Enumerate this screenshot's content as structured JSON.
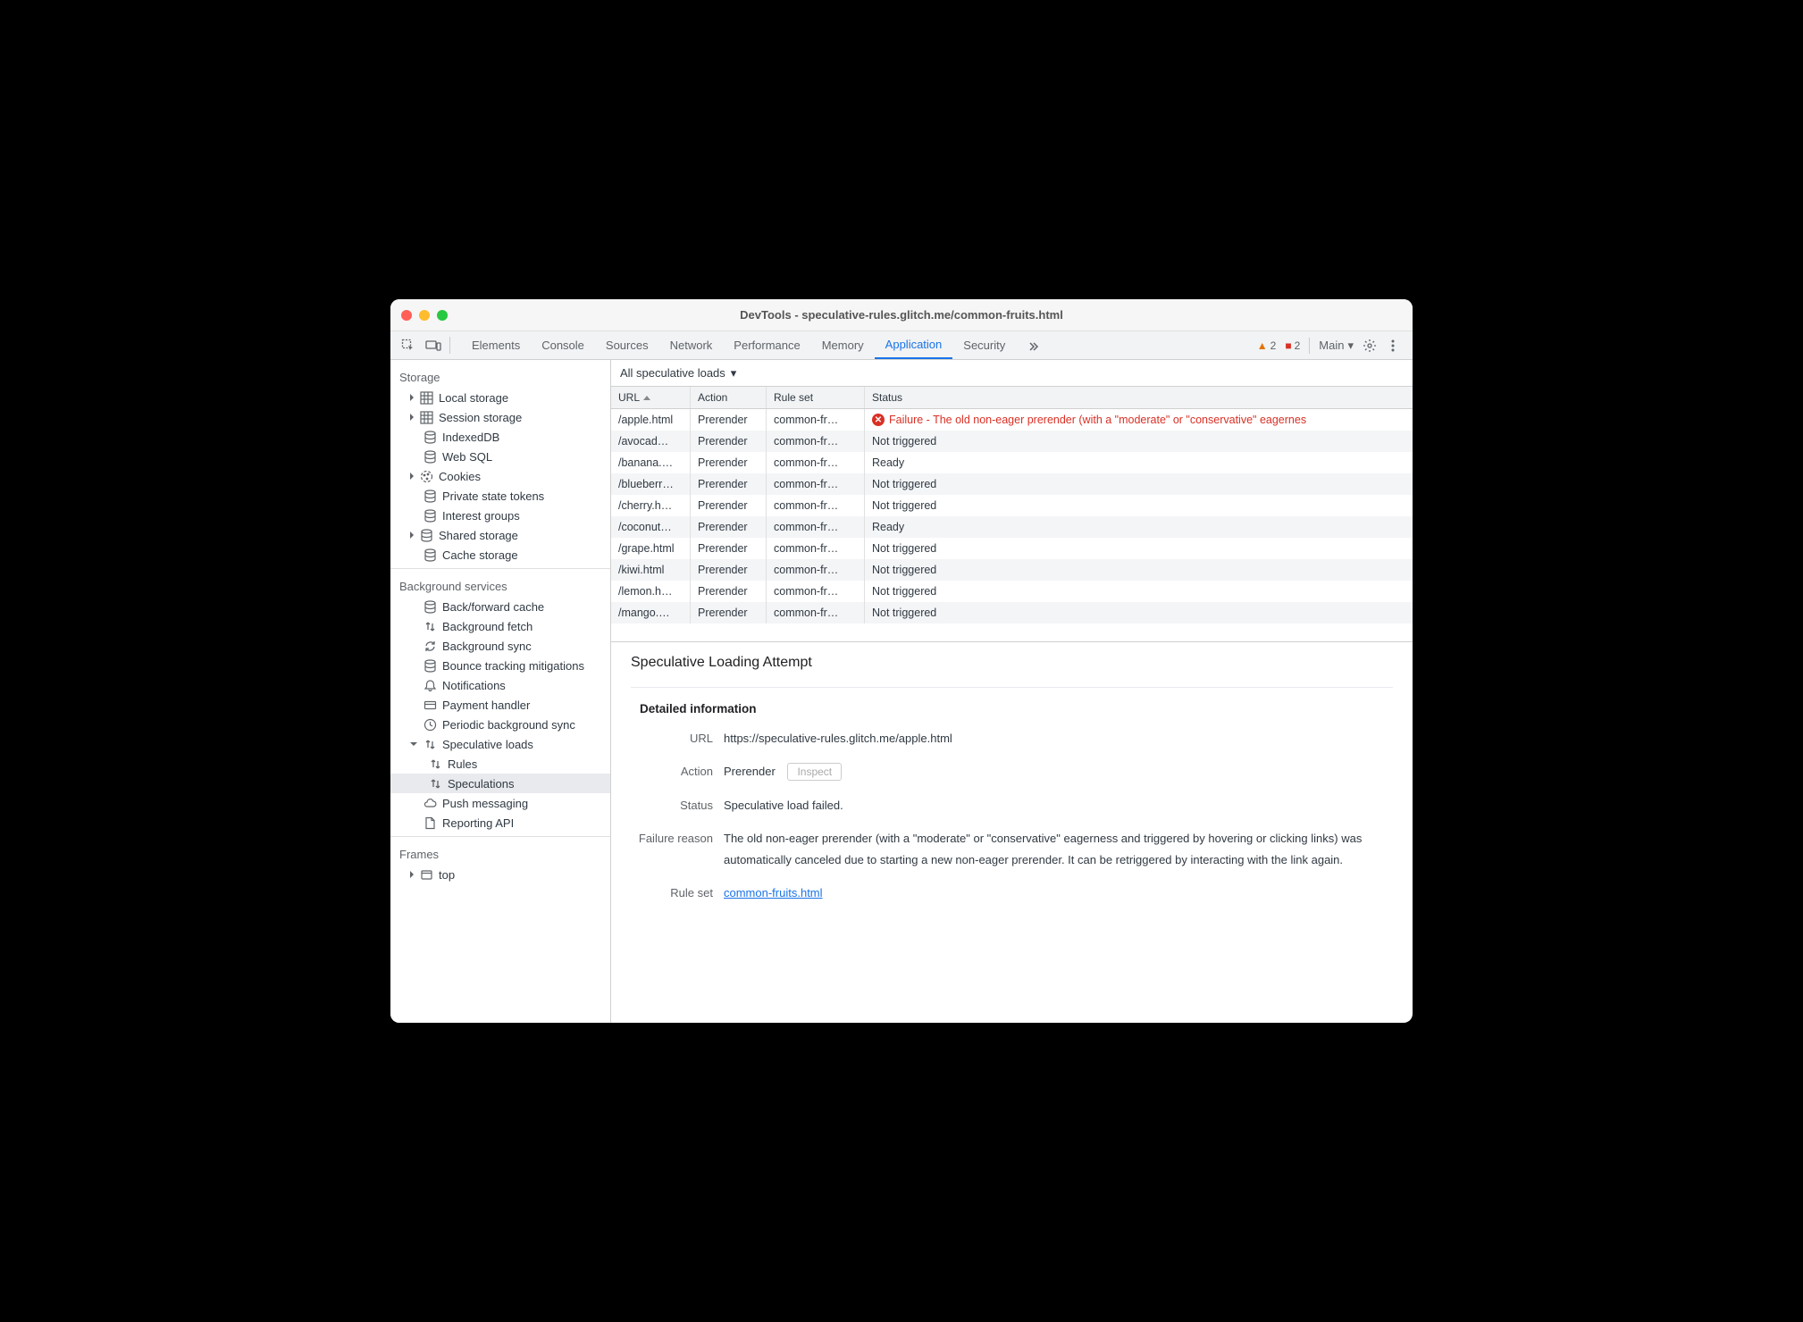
{
  "window_title": "DevTools - speculative-rules.glitch.me/common-fruits.html",
  "tabs": [
    "Elements",
    "Console",
    "Sources",
    "Network",
    "Performance",
    "Memory",
    "Application",
    "Security"
  ],
  "active_tab": "Application",
  "warnings_count": "2",
  "errors_count": "2",
  "target_label": "Main",
  "sidebar": {
    "storage_heading": "Storage",
    "storage_items": [
      {
        "label": "Local storage",
        "icon": "grid",
        "expandable": true
      },
      {
        "label": "Session storage",
        "icon": "grid",
        "expandable": true
      },
      {
        "label": "IndexedDB",
        "icon": "db"
      },
      {
        "label": "Web SQL",
        "icon": "db"
      },
      {
        "label": "Cookies",
        "icon": "cookie",
        "expandable": true
      },
      {
        "label": "Private state tokens",
        "icon": "db"
      },
      {
        "label": "Interest groups",
        "icon": "db"
      },
      {
        "label": "Shared storage",
        "icon": "db",
        "expandable": true
      },
      {
        "label": "Cache storage",
        "icon": "db"
      }
    ],
    "bg_heading": "Background services",
    "bg_items": [
      {
        "label": "Back/forward cache",
        "icon": "db"
      },
      {
        "label": "Background fetch",
        "icon": "updown"
      },
      {
        "label": "Background sync",
        "icon": "sync"
      },
      {
        "label": "Bounce tracking mitigations",
        "icon": "db"
      },
      {
        "label": "Notifications",
        "icon": "bell"
      },
      {
        "label": "Payment handler",
        "icon": "card"
      },
      {
        "label": "Periodic background sync",
        "icon": "clock"
      },
      {
        "label": "Speculative loads",
        "icon": "updown",
        "expandable": true,
        "expanded": true
      },
      {
        "label": "Rules",
        "icon": "updown",
        "child": true
      },
      {
        "label": "Speculations",
        "icon": "updown",
        "child": true,
        "selected": true
      },
      {
        "label": "Push messaging",
        "icon": "cloud"
      },
      {
        "label": "Reporting API",
        "icon": "file"
      }
    ],
    "frames_heading": "Frames",
    "frames_items": [
      {
        "label": "top",
        "icon": "frame",
        "expandable": true
      }
    ]
  },
  "filter_label": "All speculative loads",
  "table": {
    "headers": [
      "URL",
      "Action",
      "Rule set",
      "Status"
    ],
    "rows": [
      {
        "url": "/apple.html",
        "action": "Prerender",
        "ruleset": "common-fr…",
        "status": "Failure - The old non-eager prerender (with a \"moderate\" or \"conservative\" eagernes",
        "fail": true
      },
      {
        "url": "/avocad…",
        "action": "Prerender",
        "ruleset": "common-fr…",
        "status": "Not triggered"
      },
      {
        "url": "/banana.…",
        "action": "Prerender",
        "ruleset": "common-fr…",
        "status": "Ready"
      },
      {
        "url": "/blueberr…",
        "action": "Prerender",
        "ruleset": "common-fr…",
        "status": "Not triggered"
      },
      {
        "url": "/cherry.h…",
        "action": "Prerender",
        "ruleset": "common-fr…",
        "status": "Not triggered"
      },
      {
        "url": "/coconut…",
        "action": "Prerender",
        "ruleset": "common-fr…",
        "status": "Ready"
      },
      {
        "url": "/grape.html",
        "action": "Prerender",
        "ruleset": "common-fr…",
        "status": "Not triggered"
      },
      {
        "url": "/kiwi.html",
        "action": "Prerender",
        "ruleset": "common-fr…",
        "status": "Not triggered"
      },
      {
        "url": "/lemon.h…",
        "action": "Prerender",
        "ruleset": "common-fr…",
        "status": "Not triggered"
      },
      {
        "url": "/mango.…",
        "action": "Prerender",
        "ruleset": "common-fr…",
        "status": "Not triggered"
      }
    ]
  },
  "detail": {
    "title": "Speculative Loading Attempt",
    "subtitle": "Detailed information",
    "url_label": "URL",
    "url_value": "https://speculative-rules.glitch.me/apple.html",
    "action_label": "Action",
    "action_value": "Prerender",
    "inspect_label": "Inspect",
    "status_label": "Status",
    "status_value": "Speculative load failed.",
    "failure_label": "Failure reason",
    "failure_value": "The old non-eager prerender (with a \"moderate\" or \"conservative\" eagerness and triggered by hovering or clicking links) was automatically canceled due to starting a new non-eager prerender. It can be retriggered by interacting with the link again.",
    "ruleset_label": "Rule set",
    "ruleset_value": "common-fruits.html"
  }
}
